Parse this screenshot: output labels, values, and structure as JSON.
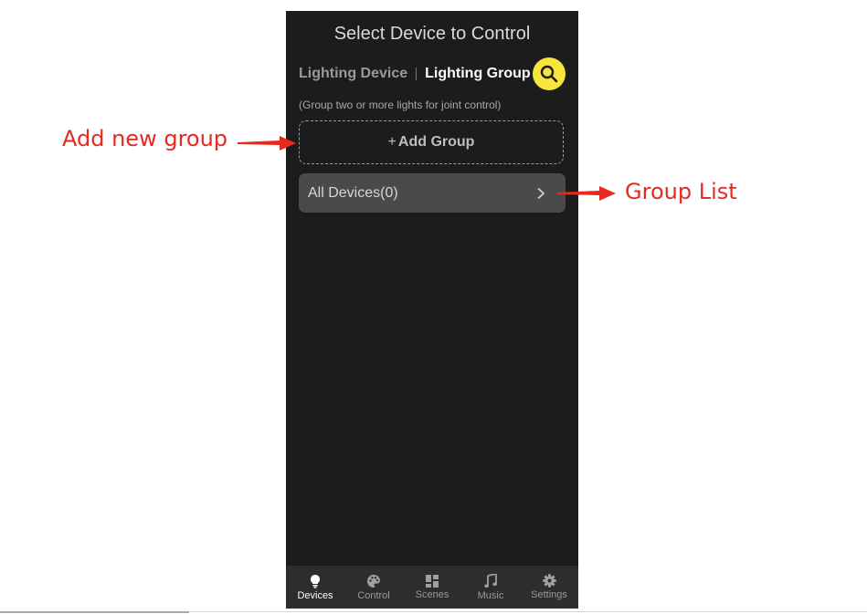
{
  "header": {
    "title": "Select Device to Control"
  },
  "tabs": {
    "device": "Lighting Device",
    "group": "Lighting Group"
  },
  "search": {
    "icon": "search-icon"
  },
  "hint": "(Group two or more lights for joint control)",
  "add_group": {
    "plus": "+",
    "label": "Add Group"
  },
  "groups": [
    {
      "label": "All Devices(0)"
    }
  ],
  "nav": [
    {
      "label": "Devices",
      "icon": "bulb-icon"
    },
    {
      "label": "Control",
      "icon": "palette-icon"
    },
    {
      "label": "Scenes",
      "icon": "grid-icon"
    },
    {
      "label": "Music",
      "icon": "music-note-icon"
    },
    {
      "label": "Settings",
      "icon": "gear-icon"
    }
  ],
  "annotations": {
    "add_new_group": "Add new group",
    "group_list": "Group List"
  },
  "colors": {
    "accent": "#f6e53c",
    "annotation": "#e8291f",
    "background": "#1c1c1c"
  }
}
